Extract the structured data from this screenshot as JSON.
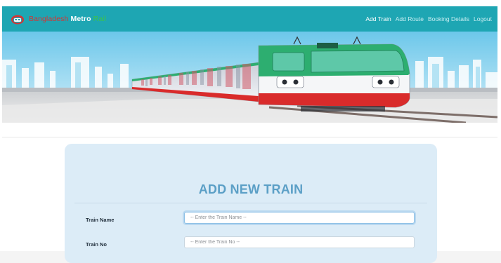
{
  "brand": {
    "word1": "Bangladesh",
    "word2": "Metro",
    "word3": "Rail"
  },
  "nav": {
    "items": [
      {
        "label": "Add Train",
        "active": true
      },
      {
        "label": "Add Route",
        "active": false
      },
      {
        "label": "Booking Details",
        "active": false
      },
      {
        "label": "Logout",
        "active": false
      }
    ]
  },
  "form": {
    "title": "ADD NEW TRAIN",
    "fields": [
      {
        "label": "Train Name",
        "placeholder": "-- Enter the Train Name --",
        "value": ""
      },
      {
        "label": "Train No",
        "placeholder": "-- Enter the Train No --",
        "value": ""
      }
    ]
  },
  "colors": {
    "navbar": "#1ea6b3",
    "card": "#dcecf7",
    "title": "#5b9fc6",
    "train_green": "#2dae70",
    "train_red": "#d92b2b"
  },
  "icons": {
    "logo": "metro-logo-icon"
  }
}
